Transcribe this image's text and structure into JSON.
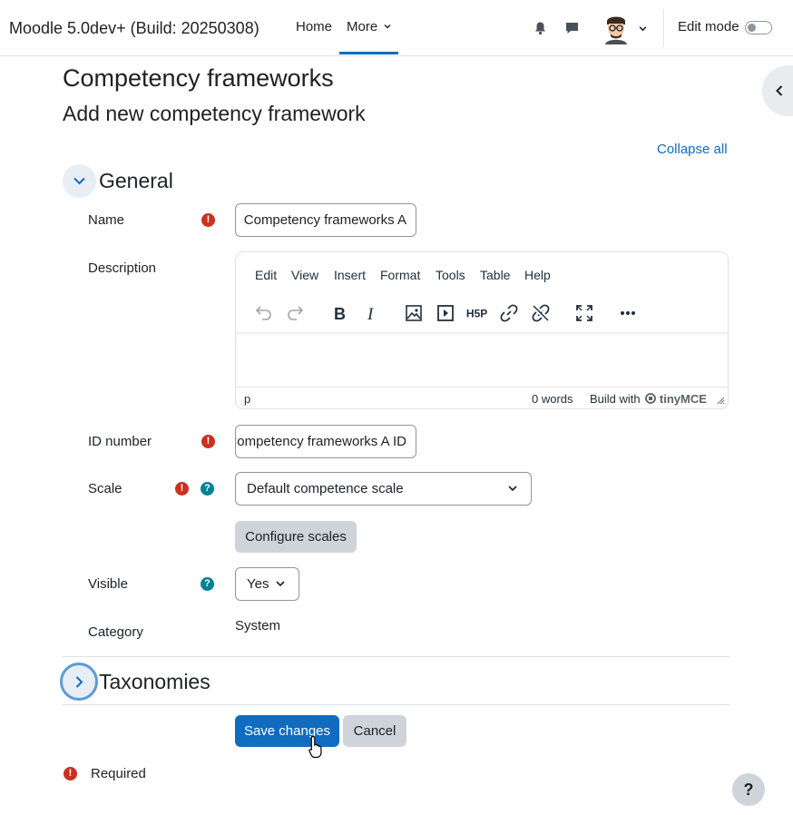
{
  "navbar": {
    "brand": "Moodle 5.0dev+ (Build: 20250308)",
    "links": [
      {
        "label": "Home"
      },
      {
        "label": "More"
      }
    ],
    "edit_mode_label": "Edit mode"
  },
  "page": {
    "title": "Competency frameworks",
    "subtitle": "Add new competency framework",
    "collapse_all": "Collapse all"
  },
  "sections": {
    "general": "General",
    "taxonomies": "Taxonomies"
  },
  "form": {
    "name_label": "Name",
    "name_value": "Competency frameworks A",
    "description_label": "Description",
    "idnumber_label": "ID number",
    "idnumber_value": "Competency frameworks A ID",
    "scale_label": "Scale",
    "scale_value": "Default competence scale",
    "configure_scales": "Configure scales",
    "visible_label": "Visible",
    "visible_value": "Yes",
    "category_label": "Category",
    "category_value": "System",
    "save": "Save changes",
    "cancel": "Cancel",
    "required_note": "Required"
  },
  "editor": {
    "menu": [
      "Edit",
      "View",
      "Insert",
      "Format",
      "Tools",
      "Table",
      "Help"
    ],
    "path": "p",
    "wordcount": "0 words",
    "branding": "Build with",
    "branding_logo": "tinyMCE",
    "toolbar_icons": [
      "undo-icon",
      "redo-icon",
      "bold-icon",
      "italic-icon",
      "image-icon",
      "media-icon",
      "h5p-icon",
      "link-icon",
      "unlink-icon",
      "fullscreen-icon",
      "more-icon"
    ]
  },
  "help_fab": "?",
  "colors": {
    "primary": "#0f6cbf",
    "required": "#ca3120",
    "help": "#008196",
    "secondary_button": "#ced4da"
  }
}
